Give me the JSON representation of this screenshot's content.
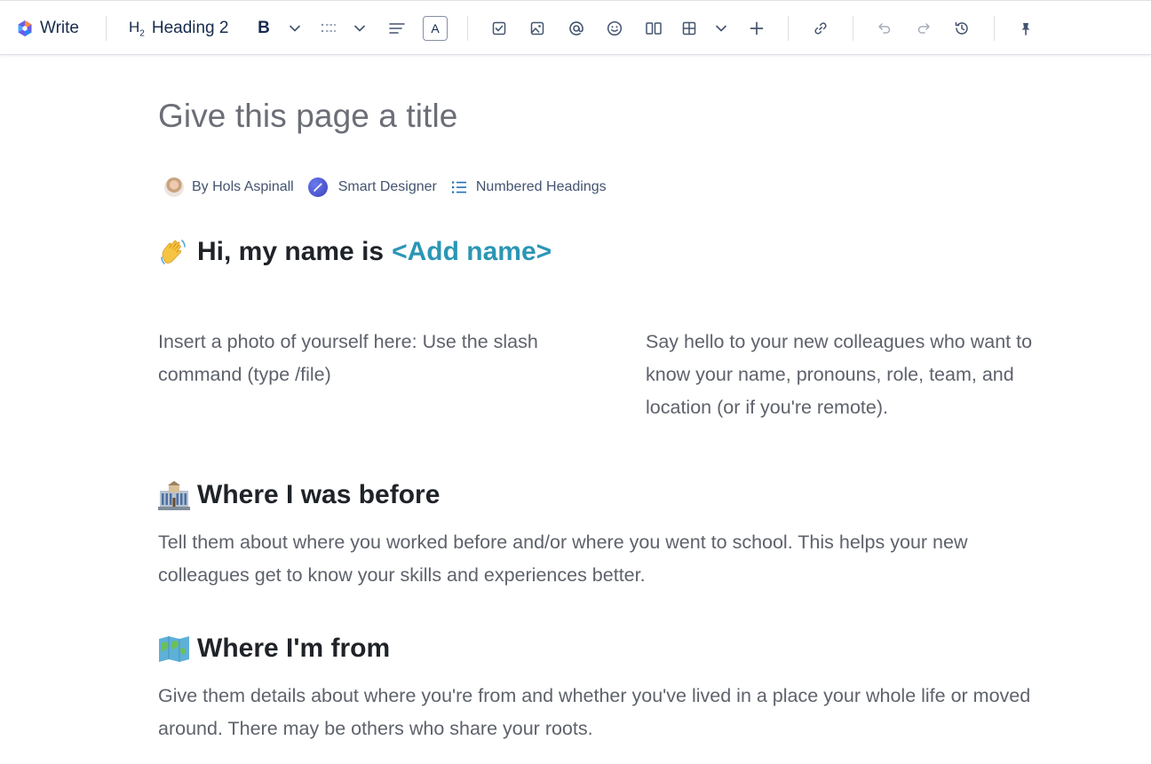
{
  "toolbar": {
    "write_label": "Write",
    "heading_prefix": "H",
    "heading_sub": "2",
    "heading_label": "Heading 2",
    "bold_label": "B",
    "text_color_label": "A"
  },
  "page": {
    "title_placeholder": "Give this page a title",
    "byline": {
      "author": "By Hols Aspinall",
      "designer": "Smart Designer",
      "numbered": "Numbered Headings"
    },
    "intro": {
      "heading_prefix": "Hi, my name is",
      "heading_placeholder": "<Add name>",
      "left_text": "Insert a photo of yourself here: Use the slash command (type /file)",
      "right_text": "Say hello to your new colleagues who want to know your name, pronouns, role, team, and location (or if you're remote)."
    },
    "sections": [
      {
        "heading": "Where I was before",
        "text": "Tell them about where you worked before and/or where you went to school. This helps your new colleagues get to know your skills and experiences better."
      },
      {
        "heading": "Where I'm from",
        "text": "Give them details about where you're from and whether you've lived in a place your whole life or moved around. There may be others who share your roots."
      }
    ]
  },
  "colors": {
    "accent_placeholder": "#2b96b5",
    "heading_text": "#1f2328",
    "body_text": "#5e626b",
    "icon": "#44546f"
  }
}
